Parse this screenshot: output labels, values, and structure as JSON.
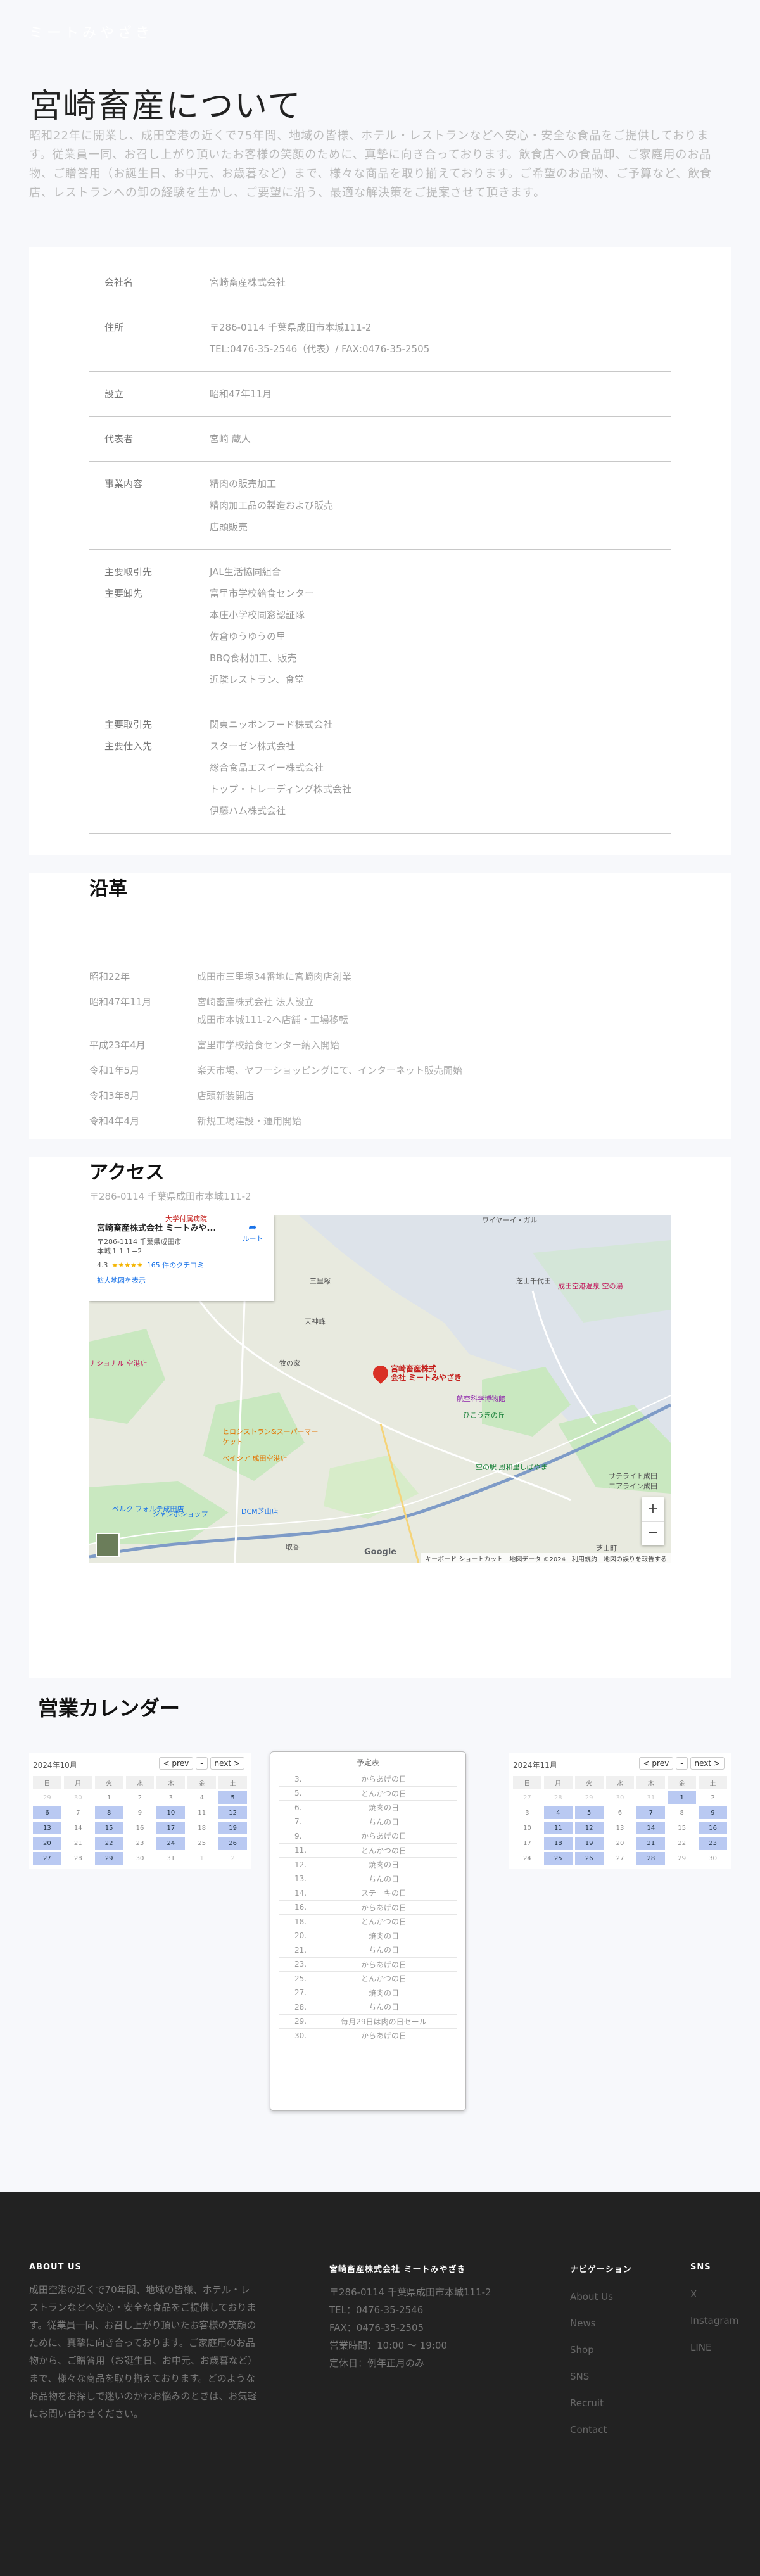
{
  "site": {
    "brand": "ミートみやざき"
  },
  "hero": {
    "title": "宮崎畜産について",
    "text": "昭和22年に開業し、成田空港の近くで75年間、地域の皆様、ホテル・レストランなどへ安心・安全な食品をご提供しております。従業員一同、お召し上がり頂いたお客様の笑顔のために、真摯に向き合っております。飲食店への食品卸、ご家庭用のお品物、ご贈答用（お誕生日、お中元、お歳暮など）まで、様々な商品を取り揃えております。ご希望のお品物、ご予算など、飲食店、レストランへの卸の経験を生かし、ご要望に沿う、最適な解決策をご提案させて頂きます。"
  },
  "company": {
    "rows": [
      {
        "key": "会社名",
        "vals": [
          "宮崎畜産株式会社"
        ]
      },
      {
        "key": "住所",
        "vals": [
          "〒286-0114 千葉県成田市本城111-2",
          "TEL:0476-35-2546（代表）/ FAX:0476-35-2505"
        ]
      },
      {
        "key": "設立",
        "vals": [
          "昭和47年11月"
        ]
      },
      {
        "key": "代表者",
        "vals": [
          "宮崎 蔵人"
        ]
      },
      {
        "key": "事業内容",
        "vals": [
          "精肉の販売加工",
          "精肉加工品の製造および販売",
          "店頭販売"
        ]
      },
      {
        "key": "主要取引先\n主要卸先",
        "vals": [
          "JAL生活協同組合",
          "富里市学校給食センター",
          "本庄小学校同窓認証隊",
          "佐倉ゆうゆうの里",
          "BBQ食材加工、販売",
          "近隣レストラン、食堂"
        ]
      },
      {
        "key": "主要取引先\n主要仕入先",
        "vals": [
          "関東ニッポンフード株式会社",
          "スターゼン株式会社",
          "総合食品エスイー株式会社",
          "トップ・トレーディング株式会社",
          "伊藤ハム株式会社"
        ]
      }
    ]
  },
  "history": {
    "title": "沿革",
    "rows": [
      {
        "key": "昭和22年",
        "vals": [
          "成田市三里塚34番地に宮崎肉店創業"
        ]
      },
      {
        "key": "昭和47年11月",
        "vals": [
          "宮崎畜産株式会社 法人設立",
          "成田市本城111-2へ店舗・工場移転"
        ]
      },
      {
        "key": "平成23年4月",
        "vals": [
          "富里市学校給食センター納入開始"
        ]
      },
      {
        "key": "令和1年5月",
        "vals": [
          "楽天市場、ヤフーショッピングにて、インターネット販売開始"
        ]
      },
      {
        "key": "令和3年8月",
        "vals": [
          "店頭新装開店"
        ]
      },
      {
        "key": "令和4年4月",
        "vals": [
          "新規工場建設・運用開始"
        ]
      }
    ]
  },
  "access": {
    "title": "アクセス",
    "address": "〒286-0114 千葉県成田市本城111-2",
    "map": {
      "card_title": "宮崎畜産株式会社 ミートみや...",
      "card_address": "〒286-1114 千葉県成田市本城１１１−2",
      "rating": "4.3",
      "reviews": "165 件のクチコミ",
      "enlarge": "拡大地図を表示",
      "route": "ルート",
      "pin_label": "宮崎畜産株式\n会社 ミートみやざき",
      "labels": {
        "l1": "大学付属病院",
        "l2": "航空科学博物館",
        "l3": "ひこうきの丘",
        "l4": "成田空港温泉 空の湯",
        "l5": "芝山千代田",
        "l6": "空の駅 風和里しばやま",
        "l7": "ベイシア 成田空港店",
        "l8": "DCM芝山店",
        "l9": "ジャンボショップ",
        "l10": "ベルク フォルテ成田店",
        "l11": "三里塚",
        "l12": "芝山町",
        "l13": "天神峰",
        "l14": "ワイヤーイ・ガル",
        "l15": "ナショナル 空港店",
        "l16": "ヒロシストラン&スーパーマーケット",
        "l17": "サテライト成田\nエアライン成田",
        "l18": "牧の家",
        "l19": "取香"
      },
      "footer": {
        "google": "Google",
        "keys": "キーボード ショートカット",
        "data": "地図データ ©2024",
        "terms": "利用規約",
        "report": "地図の誤りを報告する"
      }
    }
  },
  "calendar": {
    "title": "営業カレンダー",
    "left": {
      "label": "2024年10月",
      "prev": "< prev",
      "dash": "-",
      "next": "next >",
      "weekdays": [
        "日",
        "月",
        "火",
        "水",
        "木",
        "金",
        "土"
      ],
      "cells": [
        "29",
        "30",
        "1",
        "2",
        "3",
        "4",
        "5",
        "6",
        "7",
        "8",
        "9",
        "10",
        "11",
        "12",
        "13",
        "14",
        "15",
        "16",
        "17",
        "18",
        "19",
        "20",
        "21",
        "22",
        "23",
        "24",
        "25",
        "26",
        "27",
        "28",
        "29",
        "30",
        "31",
        "1",
        "2"
      ],
      "on": [
        6,
        7,
        9,
        11,
        13,
        14,
        16,
        18,
        20,
        21,
        23,
        25,
        27,
        28,
        30
      ],
      "out": [
        0,
        1,
        33,
        34
      ]
    },
    "right": {
      "label": "2024年11月",
      "prev": "< prev",
      "dash": "-",
      "next": "next >",
      "weekdays": [
        "日",
        "月",
        "火",
        "水",
        "木",
        "金",
        "土"
      ],
      "cells": [
        "27",
        "28",
        "29",
        "30",
        "31",
        "1",
        "2",
        "3",
        "4",
        "5",
        "6",
        "7",
        "8",
        "9",
        "10",
        "11",
        "12",
        "13",
        "14",
        "15",
        "16",
        "17",
        "18",
        "19",
        "20",
        "21",
        "22",
        "23",
        "24",
        "25",
        "26",
        "27",
        "28",
        "29",
        "30"
      ],
      "on": [
        5,
        8,
        9,
        11,
        13,
        15,
        16,
        18,
        20,
        22,
        23,
        25,
        27,
        29,
        30,
        32
      ],
      "out": [
        0,
        1,
        2,
        3,
        4
      ]
    },
    "events": {
      "head": "予定表",
      "rows": [
        {
          "d": "3.",
          "t": "からあげの日"
        },
        {
          "d": "5.",
          "t": "とんかつの日"
        },
        {
          "d": "6.",
          "t": "焼肉の日"
        },
        {
          "d": "7.",
          "t": "ちんの日"
        },
        {
          "d": "9.",
          "t": "からあげの日"
        },
        {
          "d": "11.",
          "t": "とんかつの日"
        },
        {
          "d": "12.",
          "t": "焼肉の日"
        },
        {
          "d": "13.",
          "t": "ちんの日"
        },
        {
          "d": "14.",
          "t": "ステーキの日"
        },
        {
          "d": "16.",
          "t": "からあげの日"
        },
        {
          "d": "18.",
          "t": "とんかつの日"
        },
        {
          "d": "20.",
          "t": "焼肉の日"
        },
        {
          "d": "21.",
          "t": "ちんの日"
        },
        {
          "d": "23.",
          "t": "からあげの日"
        },
        {
          "d": "25.",
          "t": "とんかつの日"
        },
        {
          "d": "27.",
          "t": "焼肉の日"
        },
        {
          "d": "28.",
          "t": "ちんの日"
        },
        {
          "d": "29.",
          "t": "毎月29日は肉の日セール"
        },
        {
          "d": "30.",
          "t": "からあげの日"
        }
      ]
    }
  },
  "footer": {
    "about_h": "ABOUT US",
    "about_t": "成田空港の近くで70年間、地域の皆様、ホテル・レストランなどへ安心・安全な食品をご提供しております。従業員一同、お召し上がり頂いたお客様の笑顔のために、真摯に向き合っております。ご家庭用のお品物から、ご贈答用（お誕生日、お中元、お歳暮など）まで、様々な商品を取り揃えております。どのようなお品物をお探しで迷いのかわお悩みのときは、お気軽にお問い合わせください。",
    "company_h": "宮崎畜産株式会社 ミートみやざき",
    "company_lines": [
      "〒286-0114 千葉県成田市本城111-2",
      "TEL：0476-35-2546",
      "FAX：0476-35-2505",
      "営業時間：10:00 ～ 19:00",
      "定休日：例年正月のみ"
    ],
    "nav_h": "ナビゲーション",
    "nav": [
      "About Us",
      "News",
      "Shop",
      "SNS",
      "Recruit",
      "Contact"
    ],
    "sns_h": "SNS",
    "sns": [
      "X",
      "Instagram",
      "LINE"
    ]
  },
  "colors": {
    "accent": "#b9c9f2",
    "footer_bg": "#222222",
    "pin": "#d93025"
  }
}
